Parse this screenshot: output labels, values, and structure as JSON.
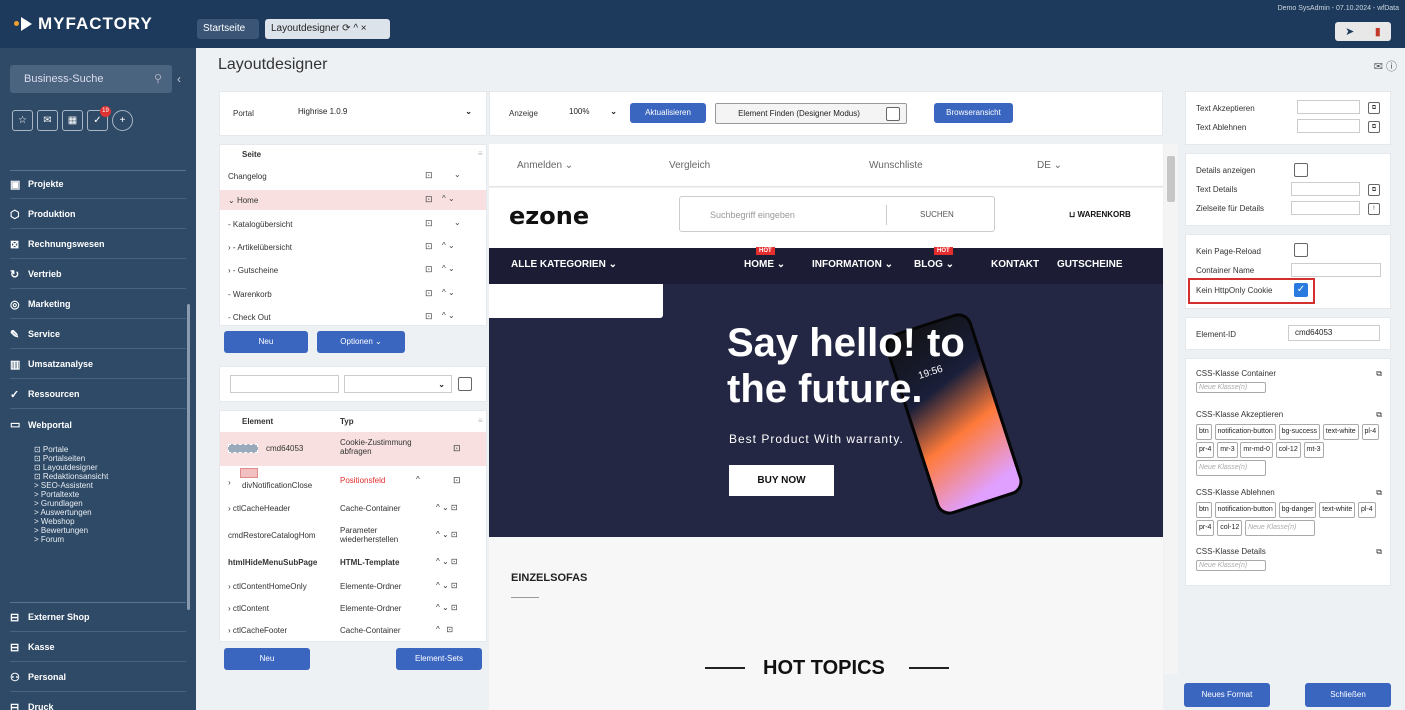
{
  "app": {
    "logo": "MYFACTORY",
    "user_info": "Demo SysAdmin - 07.10.2024 - wfData"
  },
  "tabs": [
    {
      "label": "Startseite"
    },
    {
      "label": "Layoutdesigner ⟳ ^ ×"
    }
  ],
  "sidebar": {
    "search_placeholder": "Business-Suche",
    "badge": "19",
    "items": [
      {
        "label": "Projekte",
        "icon": "folder-icon"
      },
      {
        "label": "Produktion",
        "icon": "cube-icon"
      },
      {
        "label": "Rechnungswesen",
        "icon": "calculator-icon"
      },
      {
        "label": "Vertrieb",
        "icon": "refresh-icon"
      },
      {
        "label": "Marketing",
        "icon": "target-icon"
      },
      {
        "label": "Service",
        "icon": "wrench-icon"
      },
      {
        "label": "Umsatzanalyse",
        "icon": "chart-icon"
      },
      {
        "label": "Ressourcen",
        "icon": "check-circle-icon"
      },
      {
        "label": "Webportal",
        "icon": "window-icon"
      },
      {
        "label": "Externer Shop",
        "icon": "printer-icon"
      },
      {
        "label": "Kasse",
        "icon": "register-icon"
      },
      {
        "label": "Personal",
        "icon": "people-icon"
      },
      {
        "label": "Druck",
        "icon": "print-icon"
      }
    ],
    "webportal_sub": [
      "⊡ Portale",
      "⊡ Portalseiten",
      "⊡ Layoutdesigner",
      "⊡ Redaktionsansicht",
      "> SEO-Assistent",
      "> Portaltexte",
      "> Grundlagen",
      "> Auswertungen",
      "> Webshop",
      "> Bewertungen",
      "> Forum"
    ]
  },
  "page": {
    "title": "Layoutdesigner"
  },
  "portal": {
    "label": "Portal",
    "value": "Highrise 1.0.9"
  },
  "toolbar": {
    "anzeige_label": "Anzeige",
    "zoom": "100%",
    "refresh": "Aktualisieren",
    "find_element": "Element Finden (Designer Modus)",
    "browser_view": "Browseransicht"
  },
  "seite_tree": {
    "header": "Seite",
    "rows": [
      "Changelog",
      "Home",
      "- Katalogübersicht",
      "- Artikelübersicht",
      "- Gutscheine",
      "- Warenkorb",
      "- Check Out"
    ],
    "new_btn": "Neu",
    "options_btn": "Optionen ⌄"
  },
  "element_table": {
    "headers": [
      "Element",
      "Typ"
    ],
    "rows": [
      {
        "element": "cmd64053",
        "typ": "Cookie-Zustimmung abfragen"
      },
      {
        "element": "divNotificationClose",
        "typ": "Positionsfeld"
      },
      {
        "element": "ctlCacheHeader",
        "typ": "Cache-Container"
      },
      {
        "element": "cmdRestoreCatalogHom",
        "typ": "Parameter wiederherstellen"
      },
      {
        "element": "htmlHideMenuSubPage",
        "typ": "HTML-Template"
      },
      {
        "element": "ctlContentHomeOnly",
        "typ": "Elemente-Ordner"
      },
      {
        "element": "ctlContent",
        "typ": "Elemente-Ordner"
      },
      {
        "element": "ctlCacheFooter",
        "typ": "Cache-Container"
      }
    ],
    "new_btn": "Neu",
    "sets_btn": "Element-Sets"
  },
  "site": {
    "topbar": [
      "Anmelden ⌄",
      "Vergleich",
      "Wunschliste",
      "DE ⌄"
    ],
    "logo": "ezone",
    "search_placeholder": "Suchbegriff eingeben",
    "search_btn": "SUCHEN",
    "cart": "WARENKORB",
    "nav": [
      "ALLE KATEGORIEN ⌄",
      "HOME ⌄",
      "INFORMATION ⌄",
      "BLOG ⌄",
      "KONTAKT",
      "GUTSCHEINE"
    ],
    "hot": "HOT",
    "hero_title_1": "Say hello! to",
    "hero_title_2": "the future.",
    "hero_sub": "Best Product With warranty.",
    "hero_btn": "BUY NOW",
    "phone_time": "19:56",
    "section1": "EINZELSOFAS",
    "section2": "HOT TOPICS"
  },
  "props": {
    "text_accept": "Text Akzeptieren",
    "text_decline": "Text Ablehnen",
    "details_show": "Details anzeigen",
    "text_details": "Text Details",
    "target_details": "Zielseite für Details",
    "no_reload": "Kein Page-Reload",
    "container_name": "Container Name",
    "httponly": "Kein HttpOnly Cookie",
    "element_id_label": "Element-ID",
    "element_id": "cmd64053",
    "css_container": "CSS-Klasse Container",
    "css_accept": "CSS-Klasse Akzeptieren",
    "css_decline": "CSS-Klasse Ablehnen",
    "css_details": "CSS-Klasse Details",
    "placeholder": "Neue Klasse(n)",
    "accept_classes": [
      "btn",
      "notification-button",
      "bg-success",
      "text-white",
      "pl-4",
      "pr-4",
      "mr-3",
      "mr-md-0",
      "col-12",
      "mt-3"
    ],
    "decline_classes": [
      "btn",
      "notification-button",
      "bg-danger",
      "text-white",
      "pl-4",
      "pr-4",
      "col-12"
    ],
    "new_format": "Neues Format",
    "close": "Schließen"
  },
  "colors": {
    "topbar": "#1d3a5c",
    "sidebar": "#2f4a66",
    "primary": "#3a66c0",
    "highlight": "#f7e0df",
    "accent": "#e42d2d"
  }
}
